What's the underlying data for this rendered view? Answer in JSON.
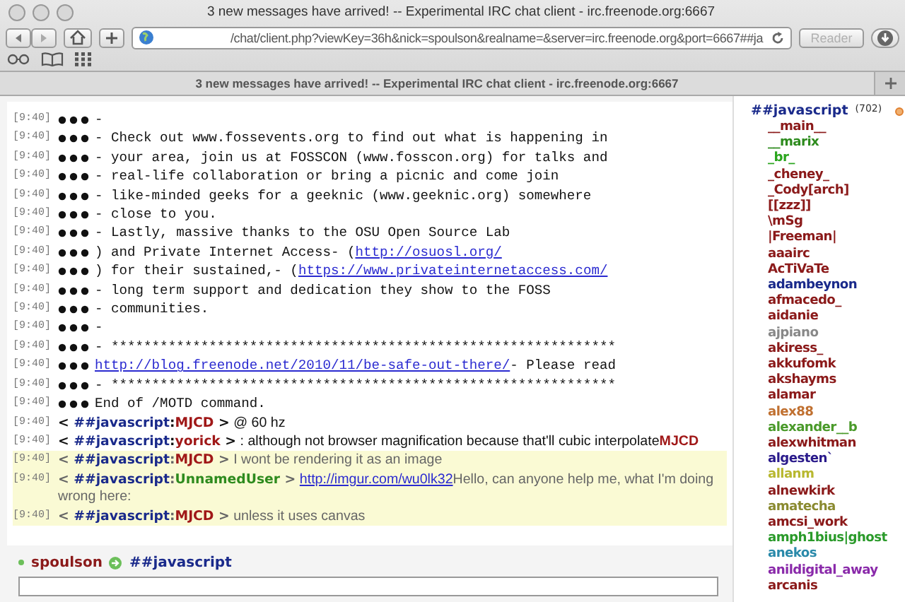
{
  "window": {
    "title": "3 new messages have arrived! -- Experimental IRC chat client - irc.freenode.org:6667"
  },
  "toolbar": {
    "url": "/chat/client.php?viewKey=36h&nick=spoulson&realname=&server=irc.freenode.org&port=6667##ja",
    "reader": {
      "label": "Reader",
      "disabled": true
    }
  },
  "tabs": [
    {
      "label": "3 new messages have arrived! -- Experimental IRC chat client - irc.freenode.org:6667",
      "selected": true
    }
  ],
  "messages": [
    {
      "kind": "server",
      "time": "[9:40]",
      "highlighted": false,
      "parts": [
        {
          "kind": "text",
          "text": "-"
        }
      ]
    },
    {
      "kind": "server",
      "time": "[9:40]",
      "highlighted": false,
      "parts": [
        {
          "kind": "text",
          "text": "- Check out www.fossevents.org to find out what is happening in"
        }
      ]
    },
    {
      "kind": "server",
      "time": "[9:40]",
      "highlighted": false,
      "parts": [
        {
          "kind": "text",
          "text": "- your area, join us at FOSSCON (www.fosscon.org) for talks and"
        }
      ]
    },
    {
      "kind": "server",
      "time": "[9:40]",
      "highlighted": false,
      "parts": [
        {
          "kind": "text",
          "text": "- real-life collaboration or bring a picnic and come join"
        }
      ]
    },
    {
      "kind": "server",
      "time": "[9:40]",
      "highlighted": false,
      "parts": [
        {
          "kind": "text",
          "text": "- like-minded geeks for a geeknic (www.geeknic.org) somewhere"
        }
      ]
    },
    {
      "kind": "server",
      "time": "[9:40]",
      "highlighted": false,
      "parts": [
        {
          "kind": "text",
          "text": "- close to you."
        }
      ]
    },
    {
      "kind": "server",
      "time": "[9:40]",
      "highlighted": false,
      "parts": [
        {
          "kind": "text",
          "text": "- Lastly, massive thanks to the OSU Open Source Lab"
        }
      ]
    },
    {
      "kind": "server",
      "time": "[9:40]",
      "highlighted": false,
      "parts": [
        {
          "kind": "text",
          "text": ") and Private Internet Access- ("
        },
        {
          "kind": "link",
          "text": "http://osuosl.org/"
        }
      ]
    },
    {
      "kind": "server",
      "time": "[9:40]",
      "highlighted": false,
      "parts": [
        {
          "kind": "text",
          "text": ") for their sustained,- ("
        },
        {
          "kind": "link",
          "text": "https://www.privateinternetaccess.com/"
        }
      ]
    },
    {
      "kind": "server",
      "time": "[9:40]",
      "highlighted": false,
      "parts": [
        {
          "kind": "text",
          "text": "- long term support and dedication they show to the FOSS"
        }
      ]
    },
    {
      "kind": "server",
      "time": "[9:40]",
      "highlighted": false,
      "parts": [
        {
          "kind": "text",
          "text": "- communities."
        }
      ]
    },
    {
      "kind": "server",
      "time": "[9:40]",
      "highlighted": false,
      "parts": [
        {
          "kind": "text",
          "text": "-"
        }
      ]
    },
    {
      "kind": "server",
      "time": "[9:40]",
      "highlighted": false,
      "parts": [
        {
          "kind": "text",
          "text": "- **************************************************************"
        }
      ]
    },
    {
      "kind": "server",
      "time": "[9:40]",
      "highlighted": false,
      "parts": [
        {
          "kind": "link",
          "text": "http://blog.freenode.net/2010/11/be-safe-out-there/"
        },
        {
          "kind": "text",
          "text": "- Please read"
        }
      ]
    },
    {
      "kind": "server",
      "time": "[9:40]",
      "highlighted": false,
      "parts": [
        {
          "kind": "text",
          "text": "- **************************************************************"
        }
      ]
    },
    {
      "kind": "server",
      "time": "[9:40]",
      "highlighted": false,
      "parts": [
        {
          "kind": "text",
          "text": "End of /MOTD command."
        }
      ]
    },
    {
      "kind": "chat",
      "time": "[9:40]",
      "highlighted": false,
      "open": "<",
      "channel": "##javascript",
      "sep": ":",
      "nick": "MJCD",
      "close": ">",
      "color": "#a01818",
      "parts": [
        {
          "kind": "text",
          "text": "@ 60 hz"
        }
      ]
    },
    {
      "kind": "chat",
      "time": "[9:40]",
      "highlighted": false,
      "open": "<",
      "channel": "##javascript",
      "sep": ":",
      "nick": "yorick",
      "close": ">",
      "color": "#a01818",
      "parts": [
        {
          "kind": "text",
          "text": ": although not browser magnification because that'll cubic interpolate"
        },
        {
          "kind": "mention",
          "text": "MJCD",
          "color": "#a01818"
        }
      ]
    },
    {
      "kind": "chat",
      "time": "[9:40]",
      "highlighted": true,
      "open": "<",
      "channel": "##javascript",
      "sep": ":",
      "nick": "MJCD",
      "close": ">",
      "color": "#a01818",
      "parts": [
        {
          "kind": "text",
          "text": "I wont be rendering it as an image"
        }
      ]
    },
    {
      "kind": "chat",
      "time": "[9:40]",
      "highlighted": true,
      "open": "<",
      "channel": "##javascript",
      "sep": ":",
      "nick": "UnnamedUser",
      "close": ">",
      "color": "#2e8b1e",
      "parts": [
        {
          "kind": "link",
          "text": "http://imgur.com/wu0lk32"
        },
        {
          "kind": "text",
          "text": "Hello, can anyone help me, what I'm doing wrong here:"
        }
      ]
    },
    {
      "kind": "chat",
      "time": "[9:40]",
      "highlighted": true,
      "open": "<",
      "channel": "##javascript",
      "sep": ":",
      "nick": "MJCD",
      "close": ">",
      "color": "#a01818",
      "parts": [
        {
          "kind": "text",
          "text": "unless it uses canvas"
        }
      ]
    }
  ],
  "userlist": {
    "channel": "##javascript",
    "count": "(702)",
    "users": [
      {
        "name": "__main__",
        "color": "#8b1a1a"
      },
      {
        "name": "__marix",
        "color": "#2e8b1e"
      },
      {
        "name": "_br_",
        "color": "#2aa51e"
      },
      {
        "name": "_cheney_",
        "color": "#8b1a1a"
      },
      {
        "name": "_Cody[arch]",
        "color": "#8b1a1a"
      },
      {
        "name": "[[zzz]]",
        "color": "#8b1a1a"
      },
      {
        "name": "\\mSg",
        "color": "#8b1a1a"
      },
      {
        "name": "|Freeman|",
        "color": "#8b1a1a"
      },
      {
        "name": "aaairc",
        "color": "#8b1a1a"
      },
      {
        "name": "AcTiVaTe",
        "color": "#8b1a1a"
      },
      {
        "name": "adambeynon",
        "color": "#1a2a8b"
      },
      {
        "name": "afmacedo_",
        "color": "#8b1a1a"
      },
      {
        "name": "aidanie",
        "color": "#8b1a1a"
      },
      {
        "name": "ajpiano",
        "color": "#888888"
      },
      {
        "name": "akiress_",
        "color": "#8b1a1a"
      },
      {
        "name": "akkufomk",
        "color": "#8b1a1a"
      },
      {
        "name": "akshayms",
        "color": "#8b1a1a"
      },
      {
        "name": "alamar",
        "color": "#8b1a1a"
      },
      {
        "name": "alex88",
        "color": "#c07030"
      },
      {
        "name": "alexander__b",
        "color": "#4a9a2a"
      },
      {
        "name": "alexwhitman",
        "color": "#8b1a1a"
      },
      {
        "name": "algesten`",
        "color": "#2a1a8b"
      },
      {
        "name": "allanm",
        "color": "#b8b830"
      },
      {
        "name": "alnewkirk",
        "color": "#8b1a1a"
      },
      {
        "name": "amatecha",
        "color": "#8a8a30"
      },
      {
        "name": "amcsi_work",
        "color": "#8b1a1a"
      },
      {
        "name": "amph1bius|ghost",
        "color": "#2a9a2a"
      },
      {
        "name": "anekos",
        "color": "#2a8aaa"
      },
      {
        "name": "anildigital_away",
        "color": "#8a2aaa"
      },
      {
        "name": "arcanis",
        "color": "#8b1a1a"
      }
    ]
  },
  "composer": {
    "nick": "spoulson",
    "channel": "##javascript"
  }
}
